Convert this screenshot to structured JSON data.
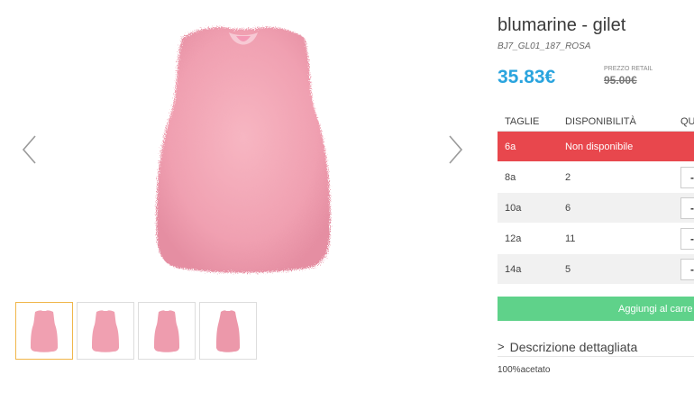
{
  "gallery": {
    "main_image": "pink-feather-gilet",
    "thumbnails": [
      "pink-feather-gilet-front",
      "pink-feather-gilet-back",
      "pink-feather-gilet-side",
      "pink-feather-gilet-detail"
    ],
    "prev_icon": "chevron-left-icon",
    "next_icon": "chevron-right-icon"
  },
  "product": {
    "title": "blumarine - gilet",
    "sku": "BJ7_GL01_187_ROSA",
    "price": "35.83€",
    "retail_label": "PREZZO RETAIL",
    "retail_price": "95.00€"
  },
  "sizes_table": {
    "headers": [
      "TAGLIE",
      "DISPONIBILITÀ",
      "QU"
    ],
    "rows": [
      {
        "size": "6a",
        "availability": "Non disponibile",
        "stepper": ""
      },
      {
        "size": "8a",
        "availability": "2",
        "stepper": "-"
      },
      {
        "size": "10a",
        "availability": "6",
        "stepper": "-"
      },
      {
        "size": "12a",
        "availability": "11",
        "stepper": "-"
      },
      {
        "size": "14a",
        "availability": "5",
        "stepper": "-"
      }
    ]
  },
  "cart_button": "Aggiungi al carre",
  "description": {
    "toggle_icon": ">",
    "toggle_label": "Descrizione dettagliata",
    "text": "100%acetato"
  },
  "colors": {
    "accent_price": "#2aa4de",
    "unavailable": "#e8474d",
    "cart": "#5fd28a",
    "thumb_active": "#f0b64a",
    "product_pink": "#f2a3b3"
  }
}
